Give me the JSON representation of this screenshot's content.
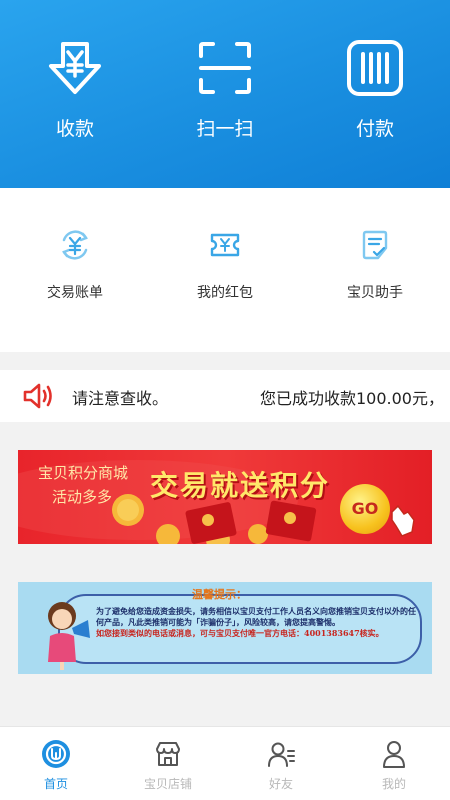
{
  "top_actions": [
    {
      "label": "收款",
      "icon": "receive-money-icon"
    },
    {
      "label": "扫一扫",
      "icon": "scan-icon"
    },
    {
      "label": "付款",
      "icon": "barcode-pay-icon"
    }
  ],
  "quick_actions": [
    {
      "label": "交易账单",
      "icon": "yuan-refresh-icon"
    },
    {
      "label": "我的红包",
      "icon": "red-packet-ticket-icon"
    },
    {
      "label": "宝贝助手",
      "icon": "clipboard-check-icon"
    }
  ],
  "notice": {
    "icon": "speaker-icon",
    "text_1": "请注意查收。",
    "text_2": "您已成功收款100.00元，"
  },
  "promo_banner": {
    "line_1": "宝贝积分商城",
    "line_2": "活动多多",
    "headline": "交易就送积分",
    "go_label": "GO"
  },
  "tips_banner": {
    "title": "温馨提示：",
    "body_1": "为了避免给您造成资金损失，请务相信以宝贝支付工作人员名义向您推销宝贝支付以外的任何产品，凡此类推销可能为「诈骗份子」，风险较高，请您提高警惕。",
    "body_2": "如您接到类似的电话或消息，可与宝贝支付唯一官方电话：4001383647核实。"
  },
  "tabs": [
    {
      "label": "首页",
      "icon": "home-icon",
      "active": true
    },
    {
      "label": "宝贝店铺",
      "icon": "store-icon",
      "active": false
    },
    {
      "label": "好友",
      "icon": "friends-icon",
      "active": false
    },
    {
      "label": "我的",
      "icon": "profile-icon",
      "active": false
    }
  ],
  "colors": {
    "primary_blue": "#1a8fe0",
    "banner_red": "#e8242b",
    "speaker_red": "#e2312b",
    "tab_inactive": "#b8b8b8"
  }
}
